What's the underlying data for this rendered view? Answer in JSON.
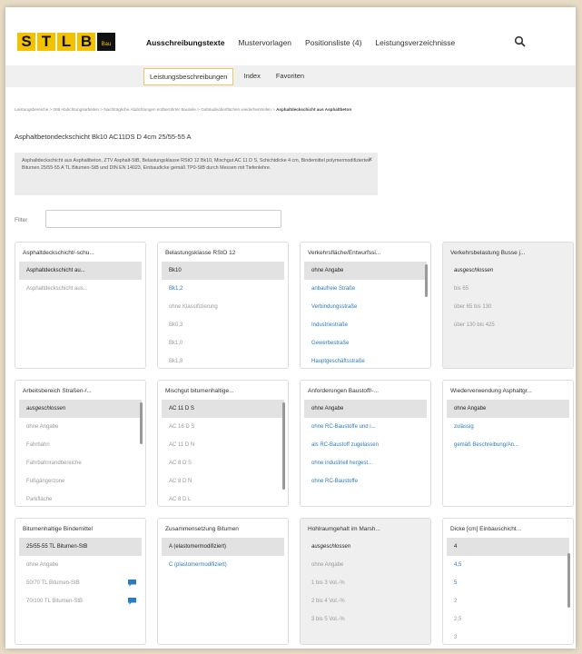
{
  "logo": {
    "letters": [
      "S",
      "T",
      "L",
      "B"
    ],
    "sub": "Bau"
  },
  "nav": {
    "items": [
      "Ausschreibungstexte",
      "Mustervorlagen",
      "Positionsliste (4)",
      "Leistungsverzeichnisse"
    ]
  },
  "subnav": {
    "tabs": [
      "Leistungsbeschreibungen",
      "Index",
      "Favoriten"
    ]
  },
  "breadcrumb": {
    "path": "Leistungsbereiche > 068 Abdichtungsarbeiten > Nachträgliche Abdichtungen erdberührter Bauteile > Gebäudeoberflächen wiederherstellen > ",
    "current": "Asphaltdeckschicht aus Asphaltbeton"
  },
  "page": {
    "title": "Asphaltbetondeckschicht Bk10 AC11DS D 4cm 25/55-55 A",
    "description": "Asphaltdeckschicht aus Asphaltbeton, ZTV Asphalt-StB, Belastungsklasse RStO 12 Bk10, Mischgut AC 11 D S, Schichtdicke 4 cm, Bindemittel polymermodifiziertes Bitumen 25/55-55 A TL Bitumen-StB und DIN EN 14023, Einbaudicke gemäß TP0-StB durch Messen mit Tiefenlehre.",
    "close_symbol": "×"
  },
  "filter": {
    "label": "Filter",
    "placeholder": ""
  },
  "cards": [
    {
      "title": "Asphaltdeckschicht/-schu...",
      "options": [
        "Asphaltdeckschicht au...",
        "Asphaltdeckschicht aus..."
      ]
    },
    {
      "title": "Belastungsklasse RStO 12",
      "options": [
        "Bk10",
        "Bk1,2",
        "ohne Klassifizierung",
        "Bk0,3",
        "Bk1,0",
        "Bk1,8"
      ]
    },
    {
      "title": "Verkehrsfläche/Entwurfssi...",
      "options": [
        "ohne Angabe",
        "anbaufreie Straße",
        "Verbindungsstraße",
        "Industriestraße",
        "Gewerbestraße",
        "Hauptgeschäftsstraße"
      ]
    },
    {
      "title": "Verkehrsbelastung Busse j...",
      "options": [
        "ausgeschlossen",
        "bis 65",
        "über 65 bis 130",
        "über 130 bis 425"
      ]
    },
    {
      "title": "Arbeitsbereich Straßen-/...",
      "options": [
        "ausgeschlossen",
        "ohne Angabe",
        "Fahrbahn",
        "Fahrbahnrandbereiche",
        "Fußgängerzone",
        "Parkfläche"
      ]
    },
    {
      "title": "Mischgut bitumenhaltige...",
      "options": [
        "AC 11 D S",
        "AC 16 D S",
        "AC 11 D N",
        "AC 8 D S",
        "AC 8 D N",
        "AC 8 D L"
      ]
    },
    {
      "title": "Anforderungen Baustoff/-...",
      "options": [
        "ohne Angabe",
        "ohne RC-Baustoffe und i...",
        "als RC-Baustoff zugelassen",
        "ohne industriell hergest...",
        "ohne RC-Baustoffe"
      ]
    },
    {
      "title": "Wiederverwendung Asphaltgr...",
      "options": [
        "ohne Angabe",
        "zulässig",
        "gemäß Beschreibung/An..."
      ]
    },
    {
      "title": "Bitumenhaltige Bindemittel",
      "options": [
        "25/55-55 TL Bitumen-StB",
        "ohne Angabe",
        "50/70 TL Bitumen-StB",
        "70/100 TL Bitumen-StB"
      ]
    },
    {
      "title": "Zusammensetzung Bitumen",
      "options": [
        "A (elastomermodifiziert)",
        "C (plastomermodifiziert)"
      ]
    },
    {
      "title": "Hohlraumgehalt im Marsh...",
      "options": [
        "ausgeschlossen",
        "ohne Angabe",
        "1 bis 3 Vol.-%",
        "2 bis 4 Vol.-%",
        "3 bis 5 Vol.-%"
      ]
    },
    {
      "title": "Dicke [cm] Einbauschicht...",
      "options": [
        "4",
        "4,5",
        "5",
        "2",
        "2,5",
        "3"
      ]
    }
  ],
  "colors": {
    "accent": "#f2c200",
    "link": "#2a7bbf",
    "selected_bg": "#e2e2e2"
  },
  "icons": {
    "search": "search-icon",
    "close": "close-icon",
    "comment": "chat-icon"
  }
}
